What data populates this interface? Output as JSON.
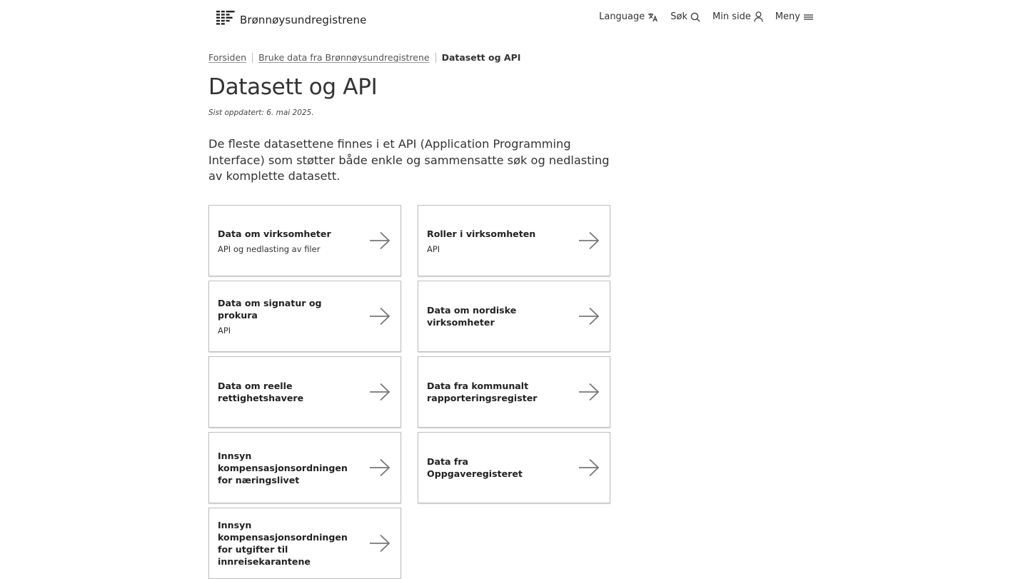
{
  "header": {
    "logo_text": "Brønnøysundregistrene",
    "nav": [
      {
        "label": "Language",
        "icon": "translate-icon"
      },
      {
        "label": "Søk",
        "icon": "search-icon"
      },
      {
        "label": "Min side",
        "icon": "person-icon"
      },
      {
        "label": "Meny",
        "icon": "hamburger-menu-icon"
      }
    ]
  },
  "breadcrumb": {
    "items": [
      "Forsiden",
      "Bruke data fra Brønnøysundregistrene"
    ],
    "current": "Datasett og API"
  },
  "page": {
    "title": "Datasett og API",
    "updated": "Sist oppdatert: 6. mai 2025.",
    "intro": "De fleste datasettene finnes i et API (Application Programming Interface) som støtter både enkle og sammensatte søk og nedlasting av komplette datasett."
  },
  "cards": [
    {
      "title": "Data om virksomheter",
      "subtitle": "API og nedlasting av filer"
    },
    {
      "title": "Roller i virksomheten",
      "subtitle": "API"
    },
    {
      "title": "Data om signatur og prokura",
      "subtitle": "API"
    },
    {
      "title": "Data om nordiske virksomheter",
      "subtitle": ""
    },
    {
      "title": "Data om reelle rettighetshavere",
      "subtitle": ""
    },
    {
      "title": "Data fra kommunalt rapporteringsregister",
      "subtitle": ""
    },
    {
      "title": "Innsyn kompensasjonsordningen for næringslivet",
      "subtitle": ""
    },
    {
      "title": "Data fra Oppgaveregisteret",
      "subtitle": ""
    },
    {
      "title": "Innsyn kompensasjonsordningen for utgifter til innreisekarantene",
      "subtitle": ""
    }
  ],
  "colors": {
    "text": "#222222",
    "card_border": "#bfbfbf",
    "arrow": "#777777"
  }
}
